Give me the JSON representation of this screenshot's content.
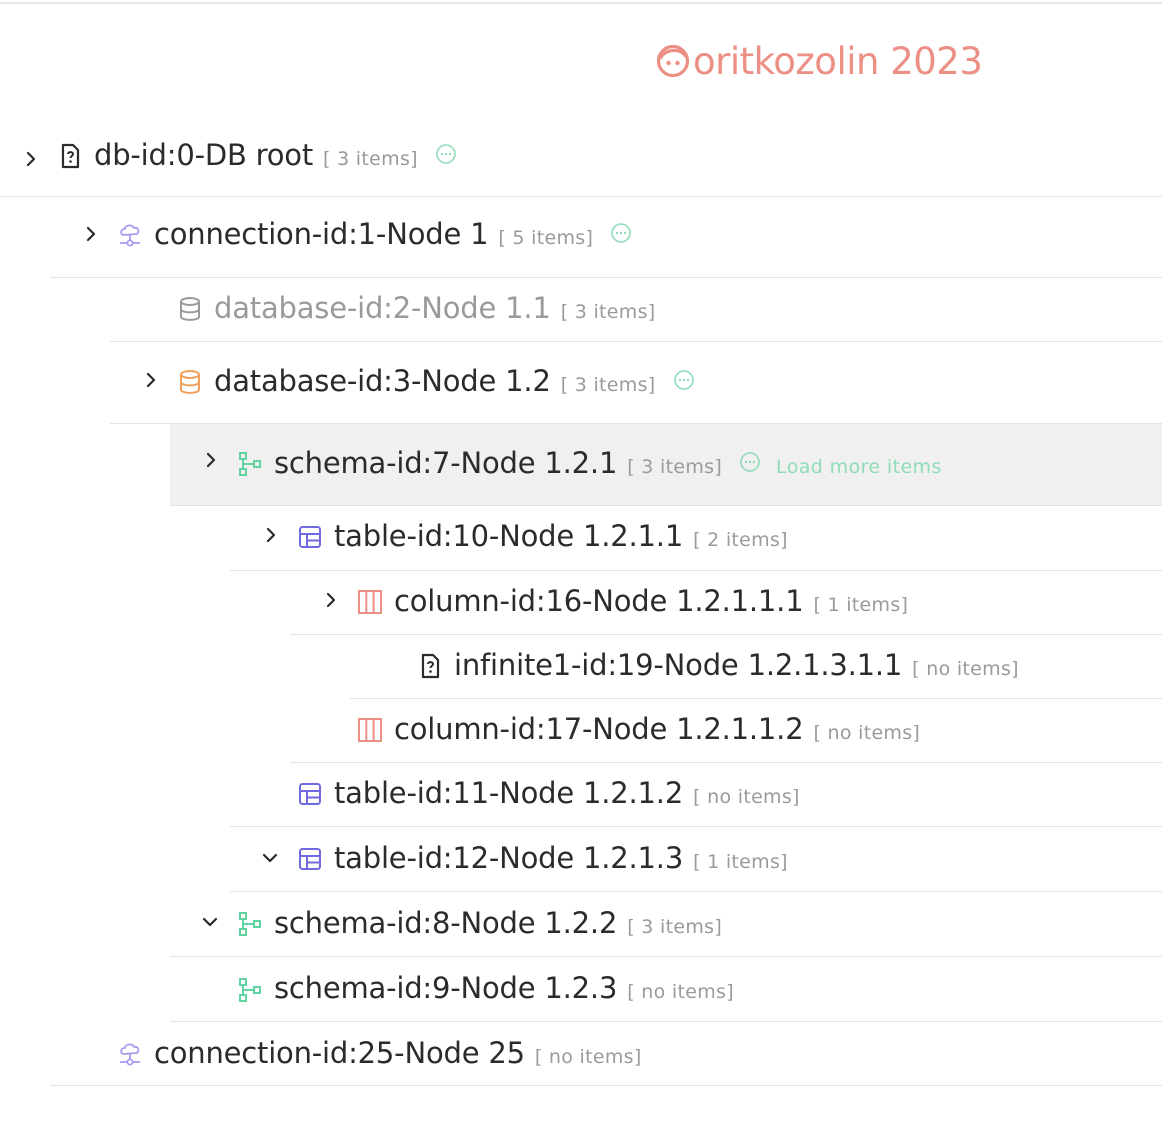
{
  "brand": {
    "text": "oritkozolin 2023",
    "color": "#ec8f84"
  },
  "tree": {
    "nodes": [
      {
        "label": "db-id:0-DB root",
        "count": "[ 3 items]",
        "icon": "file-question-icon",
        "chevron": "chevron-right",
        "more": true
      },
      {
        "label": "connection-id:1-Node 1",
        "count": "[ 5 items]",
        "icon": "connection-icon",
        "chevron": "chevron-right",
        "more": true
      },
      {
        "label": "database-id:2-Node 1.1",
        "count": "[ 3 items]",
        "icon": "database-icon",
        "chevron": "",
        "more": false,
        "disabled": true
      },
      {
        "label": "database-id:3-Node 1.2",
        "count": "[ 3 items]",
        "icon": "database-icon",
        "chevron": "chevron-right",
        "more": true
      },
      {
        "label": "schema-id:7-Node 1.2.1",
        "count": "[ 3 items]",
        "icon": "schema-icon",
        "chevron": "chevron-right",
        "more": true,
        "selected": true,
        "load_more": "Load more items"
      },
      {
        "label": "table-id:10-Node 1.2.1.1",
        "count": "[ 2 items]",
        "icon": "table-icon",
        "chevron": "chevron-right"
      },
      {
        "label": "column-id:16-Node 1.2.1.1.1",
        "count": "[ 1 items]",
        "icon": "column-icon",
        "chevron": "chevron-right"
      },
      {
        "label": "infinite1-id:19-Node 1.2.1.3.1.1",
        "count": "[ no items]",
        "icon": "file-question-icon",
        "chevron": ""
      },
      {
        "label": "column-id:17-Node 1.2.1.1.2",
        "count": "[ no items]",
        "icon": "column-icon",
        "chevron": ""
      },
      {
        "label": "table-id:11-Node 1.2.1.2",
        "count": "[ no items]",
        "icon": "table-icon",
        "chevron": ""
      },
      {
        "label": "table-id:12-Node 1.2.1.3",
        "count": "[ 1 items]",
        "icon": "table-icon",
        "chevron": "chevron-down"
      },
      {
        "label": "schema-id:8-Node 1.2.2",
        "count": "[ 3 items]",
        "icon": "schema-icon",
        "chevron": "chevron-down"
      },
      {
        "label": "schema-id:9-Node 1.2.3",
        "count": "[ no items]",
        "icon": "schema-icon",
        "chevron": ""
      },
      {
        "label": "connection-id:25-Node 25",
        "count": "[ no items]",
        "icon": "connection-icon",
        "chevron": ""
      }
    ]
  },
  "colors": {
    "more_icon": "#8fdcb8",
    "connection": "#a99cf0",
    "database_orange": "#f0a05a",
    "database_gray": "#9a9a9a",
    "schema": "#5fd3a0",
    "table": "#6f6ae0",
    "column": "#ec8f84",
    "file": "#2b2b2b"
  }
}
